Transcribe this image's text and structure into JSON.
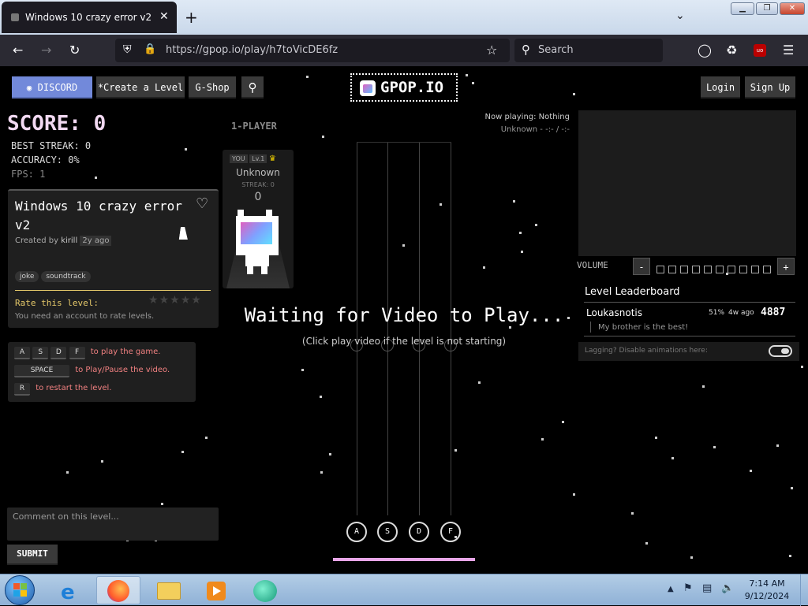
{
  "browser": {
    "tab_title": "Windows 10 crazy error v2 - Gpop",
    "url": "https://gpop.io/play/h7toVicDE6fz",
    "search_placeholder": "Search",
    "tab_close": "✕",
    "new_tab": "+"
  },
  "nav": {
    "discord_label": "DISCORD",
    "create_label": "*Create a Level",
    "gshop_label": "G-Shop",
    "logo_text": "GPOP.IO",
    "login_label": "Login",
    "signup_label": "Sign Up"
  },
  "stats": {
    "score": "SCORE: 0",
    "best_streak": "BEST STREAK: 0",
    "accuracy": "ACCURACY: 0%",
    "fps": "FPS: 1"
  },
  "level": {
    "title": "Windows 10 crazy error v2",
    "created_by_prefix": "Created by",
    "author": "kirill",
    "age": "2y ago",
    "tags": [
      "joke",
      "soundtrack"
    ],
    "rate_label": "Rate this level:",
    "rate_note": "You need an account to rate levels."
  },
  "controls": {
    "keys": [
      "A",
      "S",
      "D",
      "F"
    ],
    "keys_text": "to play the game.",
    "space_key": "SPACE",
    "space_text": "to Play/Pause the video.",
    "r_key": "R",
    "r_text": "to restart the level."
  },
  "player": {
    "mode": "1-PLAYER",
    "you_badge": "YOU",
    "level_badge": "Lv.1",
    "name": "Unknown",
    "streak": "STREAK: 0",
    "score": "0"
  },
  "game": {
    "waiting_title": "Waiting for Video to Play...",
    "waiting_sub": "(Click play video if the level is not starting)",
    "lane_keys": [
      "A",
      "S",
      "D",
      "F"
    ]
  },
  "now_playing": {
    "line1": "Now playing: Nothing",
    "line2": "Unknown - -:- / -:-"
  },
  "volume": {
    "label": "VOLUME",
    "minus": "-",
    "plus": "+",
    "level": 0,
    "steps": 10
  },
  "leaderboard": {
    "title": "Level Leaderboard",
    "entries": [
      {
        "name": "Loukasnotis",
        "accuracy": "51%",
        "age": "4w ago",
        "score": "4887",
        "comment": "My brother is the best!"
      }
    ],
    "lag_text": "Lagging? Disable animations here:"
  },
  "comment": {
    "placeholder": "Comment on this level...",
    "submit_label": "SUBMIT"
  },
  "taskbar": {
    "time": "7:14 AM",
    "date": "9/12/2024"
  },
  "colors": {
    "discord": "#7289da",
    "accent_pink": "#e8a6e8",
    "rate_yellow": "#e6c96a",
    "controls_text": "#f08080"
  }
}
